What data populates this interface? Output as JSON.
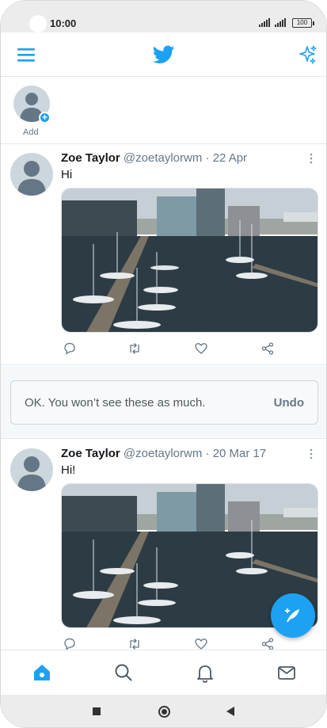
{
  "status_bar": {
    "time": "10:00",
    "battery": "100"
  },
  "header": {
    "menu_icon": "hamburger-icon",
    "logo_icon": "twitter-bird-icon",
    "sparkle_icon": "sparkle-icon"
  },
  "stories": {
    "add_label": "Add"
  },
  "tweets": [
    {
      "name": "Zoe Taylor",
      "handle": "@zoetaylorwm",
      "date": "22 Apr",
      "text": "Hi"
    },
    {
      "name": "Zoe Taylor",
      "handle": "@zoetaylorwm",
      "date": "20 Mar 17",
      "text": "Hi!"
    }
  ],
  "feedback": {
    "message": "OK. You won’t see these as much.",
    "undo_label": "Undo"
  },
  "tabs": [
    "home-icon",
    "search-icon",
    "bell-icon",
    "mail-icon"
  ],
  "colors": {
    "accent": "#1da1f2",
    "text": "#14171a",
    "secondary": "#657786"
  }
}
